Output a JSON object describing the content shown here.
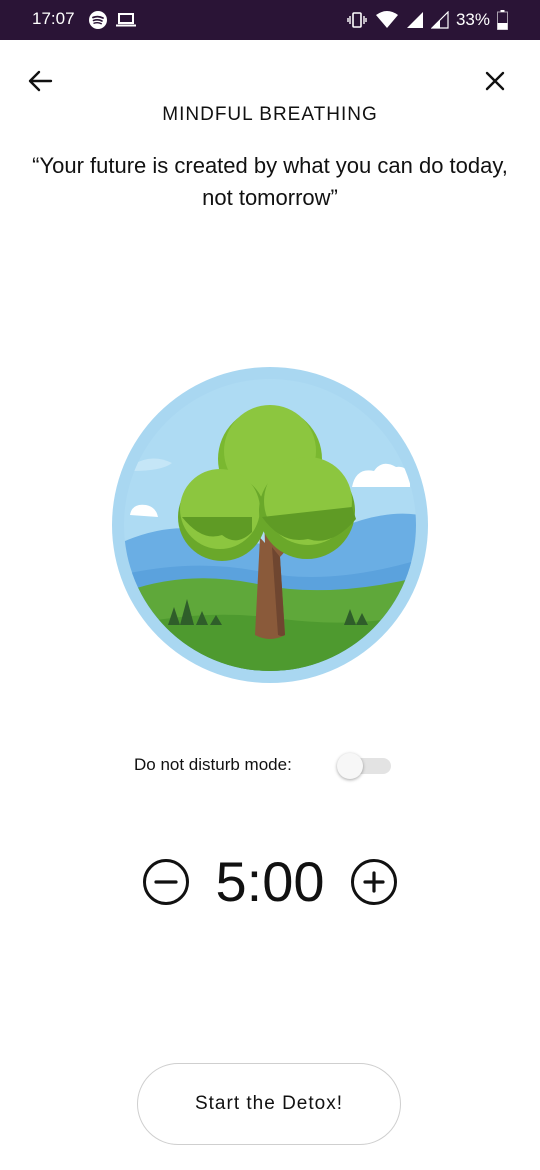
{
  "status_bar": {
    "time": "17:07",
    "battery_percent": "33%",
    "left_icons": [
      "spotify-icon",
      "laptop-icon"
    ],
    "right_icons": [
      "vibrate-icon",
      "wifi-icon",
      "signal-icon",
      "signal-icon",
      "battery-icon"
    ],
    "background_color": "#2a1436"
  },
  "header": {
    "title": "MINDFUL BREATHING",
    "back_icon": "arrow-left-icon",
    "close_icon": "close-icon"
  },
  "quote": "“Your future is created by what you can do today, not tomorrow”",
  "illustration": {
    "subject": "tree-in-landscape"
  },
  "dnd": {
    "label": "Do not disturb mode:",
    "enabled": false
  },
  "timer": {
    "value": "5:00",
    "decrement_icon": "minus-circle-icon",
    "increment_icon": "plus-circle-icon"
  },
  "start_button": {
    "label": "Start the Detox!"
  }
}
